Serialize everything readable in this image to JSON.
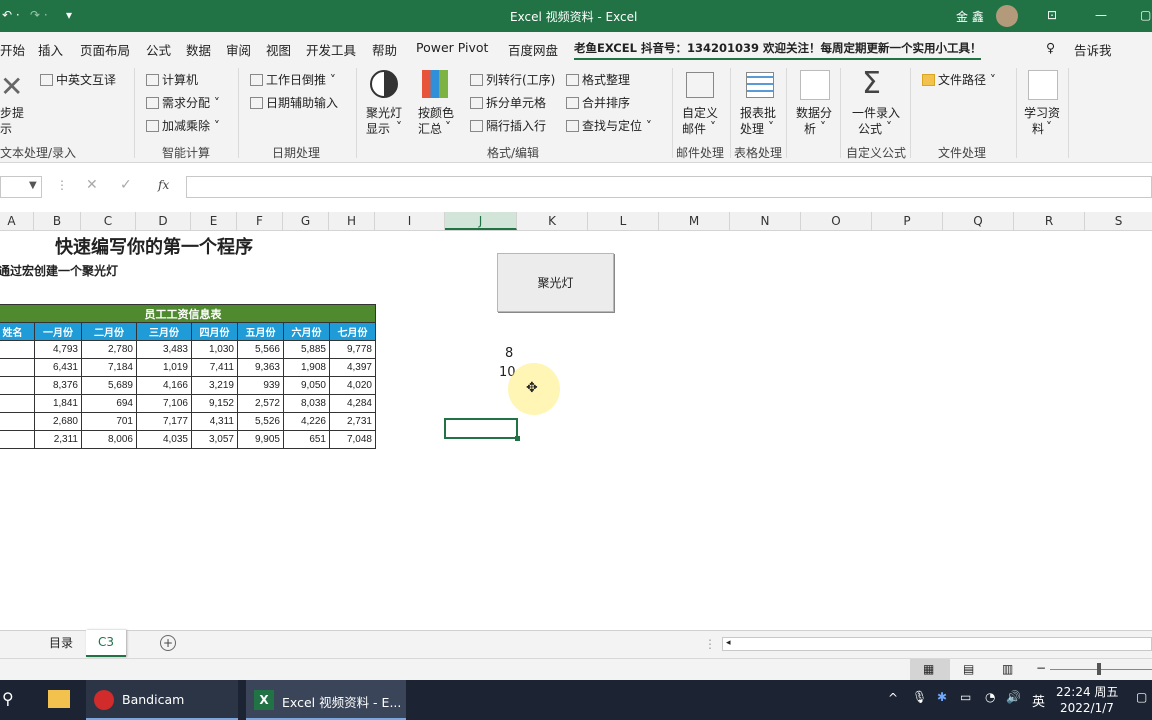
{
  "window": {
    "title": "Excel 视频资料  -  Excel",
    "user": "金 鑫"
  },
  "tabs": [
    "开始",
    "插入",
    "页面布局",
    "公式",
    "数据",
    "审阅",
    "视图",
    "开发工具",
    "帮助",
    "Power Pivot",
    "百度网盘",
    "老鱼EXCEL 抖音号：134201039 欢迎关注！每周定期更新一个实用小工具！"
  ],
  "tell_me": "告诉我",
  "ribbon": {
    "step_btn_l1": "步提",
    "step_btn_l2": "示",
    "cn_translate": "中英文互译",
    "calculator": "计算机",
    "demand_alloc": "需求分配",
    "add_sub_mul": "加减乘除",
    "workday_calc": "工作日倒推",
    "date_input": "日期辅助输入",
    "spotlight_l1": "聚光灯",
    "spotlight_l2": "显示",
    "color_sum_l1": "按颜色",
    "color_sum_l2": "汇总",
    "col_to_row": "列转行(工序)",
    "split_cells": "拆分单元格",
    "insert_rows": "隔行插入行",
    "format_tidy": "格式整理",
    "merge_sort": "合并排序",
    "find_locate": "查找与定位",
    "custom_mail_l1": "自定义",
    "custom_mail_l2": "邮件",
    "report_l1": "报表批",
    "report_l2": "处理",
    "data_analysis_l1": "数据分",
    "data_analysis_l2": "析",
    "formula_l1": "一件录入",
    "formula_l2": "公式",
    "file_path": "文件路径",
    "study_l1": "学习资",
    "study_l2": "料",
    "groups": {
      "text": "文本处理/录入",
      "smart": "智能计算",
      "date": "日期处理",
      "format": "格式/编辑",
      "mail": "邮件处理",
      "table": "表格处理",
      "custom_formula": "自定义公式",
      "file": "文件处理"
    }
  },
  "formula_bar": {
    "fx": "fx"
  },
  "columns": [
    "A",
    "B",
    "C",
    "D",
    "E",
    "F",
    "G",
    "H",
    "I",
    "J",
    "K",
    "L",
    "M",
    "N",
    "O",
    "P",
    "Q",
    "R",
    "S"
  ],
  "sheet": {
    "heading": "快速编写你的第一个程序",
    "subheading": "通过宏创建一个聚光灯",
    "macro_button": "聚光灯",
    "j_values": [
      "8",
      "10"
    ],
    "table": {
      "title": "员工工资信息表",
      "headers": [
        "姓名",
        "一月份",
        "二月份",
        "三月份",
        "四月份",
        "五月份",
        "六月份",
        "七月份"
      ],
      "rows": [
        [
          "4,793",
          "2,780",
          "3,483",
          "1,030",
          "5,566",
          "5,885",
          "9,778"
        ],
        [
          "6,431",
          "7,184",
          "1,019",
          "7,411",
          "9,363",
          "1,908",
          "4,397"
        ],
        [
          "8,376",
          "5,689",
          "4,166",
          "3,219",
          "939",
          "9,050",
          "4,020"
        ],
        [
          "1,841",
          "694",
          "7,106",
          "9,152",
          "2,572",
          "8,038",
          "4,284"
        ],
        [
          "2,680",
          "701",
          "7,177",
          "4,311",
          "5,526",
          "4,226",
          "2,731"
        ],
        [
          "2,311",
          "8,006",
          "4,035",
          "3,057",
          "9,905",
          "651",
          "7,048"
        ]
      ]
    }
  },
  "sheet_tabs": [
    "目录",
    "C3"
  ],
  "taskbar": {
    "apps": [
      "Bandicam",
      "Excel 视频资料 - E..."
    ],
    "ime": "英",
    "time": "22:24 周五",
    "date": "2022/1/7"
  },
  "colors": {
    "excel_green": "#217346",
    "table_green": "#4f8a2f",
    "table_blue": "#1f9bd8"
  }
}
